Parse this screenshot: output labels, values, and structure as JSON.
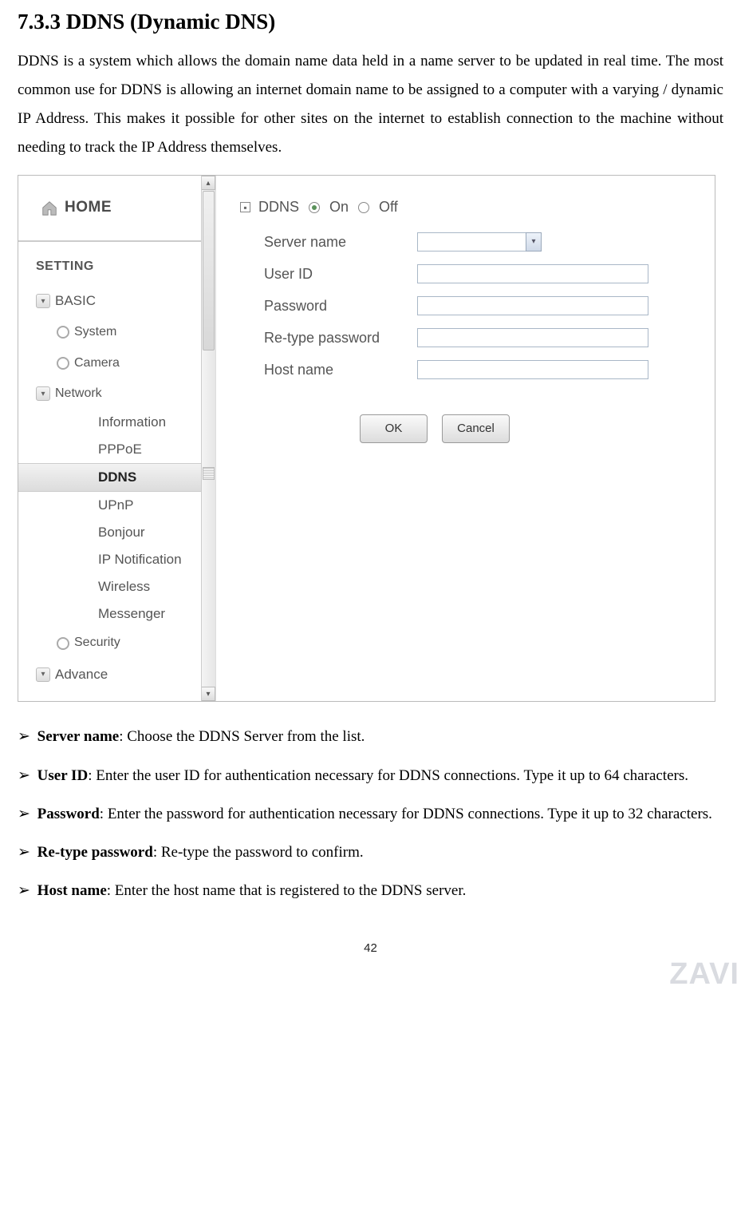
{
  "heading": "7.3.3 DDNS (Dynamic DNS)",
  "intro": "DDNS is a system which allows the domain name data held in a name server to be updated in real time. The most common use for DDNS is allowing an internet domain name to be assigned to a computer with a varying / dynamic IP Address. This makes it possible for other sites on the internet to establish connection to the machine without needing to track the IP Address themselves.",
  "sidebar": {
    "home": "HOME",
    "setting": "SETTING",
    "categories": {
      "basic": "BASIC",
      "system": "System",
      "camera": "Camera",
      "network": "Network",
      "security": "Security",
      "advance": "Advance"
    },
    "network_items": {
      "information": "Information",
      "pppoe": "PPPoE",
      "ddns": "DDNS",
      "upnp": "UPnP",
      "bonjour": "Bonjour",
      "ipnotification": "IP Notification",
      "wireless": "Wireless",
      "messenger": "Messenger"
    }
  },
  "form": {
    "title": "DDNS",
    "on": "On",
    "off": "Off",
    "labels": {
      "server_name": "Server name",
      "user_id": "User ID",
      "password": "Password",
      "retype": "Re-type password",
      "host_name": "Host name"
    },
    "buttons": {
      "ok": "OK",
      "cancel": "Cancel"
    }
  },
  "descriptions": {
    "server_name": {
      "term": "Server name",
      "body": ": Choose the DDNS Server from the list."
    },
    "user_id": {
      "term": "User ID",
      "body": ": Enter the user ID for authentication necessary for DDNS connections. Type it up to 64 characters."
    },
    "password": {
      "term": "Password",
      "body": ": Enter the password for authentication necessary for DDNS connections. Type it up to 32 characters."
    },
    "retype": {
      "term": "Re-type password",
      "body": ": Re-type the password to confirm."
    },
    "host_name": {
      "term": "Host name",
      "body": ": Enter the host name that is registered to the DDNS server."
    }
  },
  "page_number": "42",
  "logo": "ZAVI"
}
